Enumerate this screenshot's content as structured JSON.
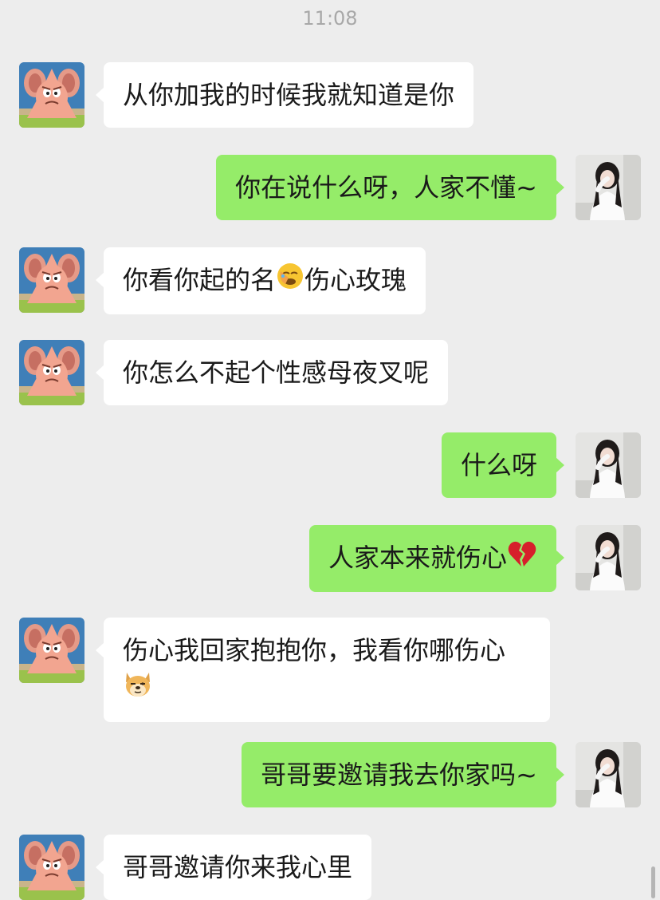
{
  "header": {
    "time": "11:08"
  },
  "messages": [
    {
      "side": "in",
      "text": "从你加我的时候我就知道是你"
    },
    {
      "side": "out",
      "text": "你在说什么呀，人家不懂~"
    },
    {
      "side": "in",
      "text_before": "你看你起的名",
      "emoji": "facepalm-emoji",
      "text_after": "伤心玫瑰"
    },
    {
      "side": "in",
      "text": "你怎么不起个性感母夜叉呢"
    },
    {
      "side": "out",
      "text": "什么呀"
    },
    {
      "side": "out",
      "text": "人家本来就伤心",
      "emoji": "broken-heart-emoji"
    },
    {
      "side": "in",
      "text": "伤心我回家抱抱你，我看你哪伤心",
      "emoji": "doge-emoji"
    },
    {
      "side": "out",
      "text": "哥哥要邀请我去你家吗~"
    },
    {
      "side": "in",
      "text": "哥哥邀请你来我心里"
    }
  ],
  "colors": {
    "background": "#ededed",
    "incoming_bubble": "#ffffff",
    "outgoing_bubble": "#95ec69",
    "timestamp": "#a8a8a8"
  },
  "avatars": {
    "incoming": "patrick-star-avatar",
    "outgoing": "user-photo-avatar"
  }
}
